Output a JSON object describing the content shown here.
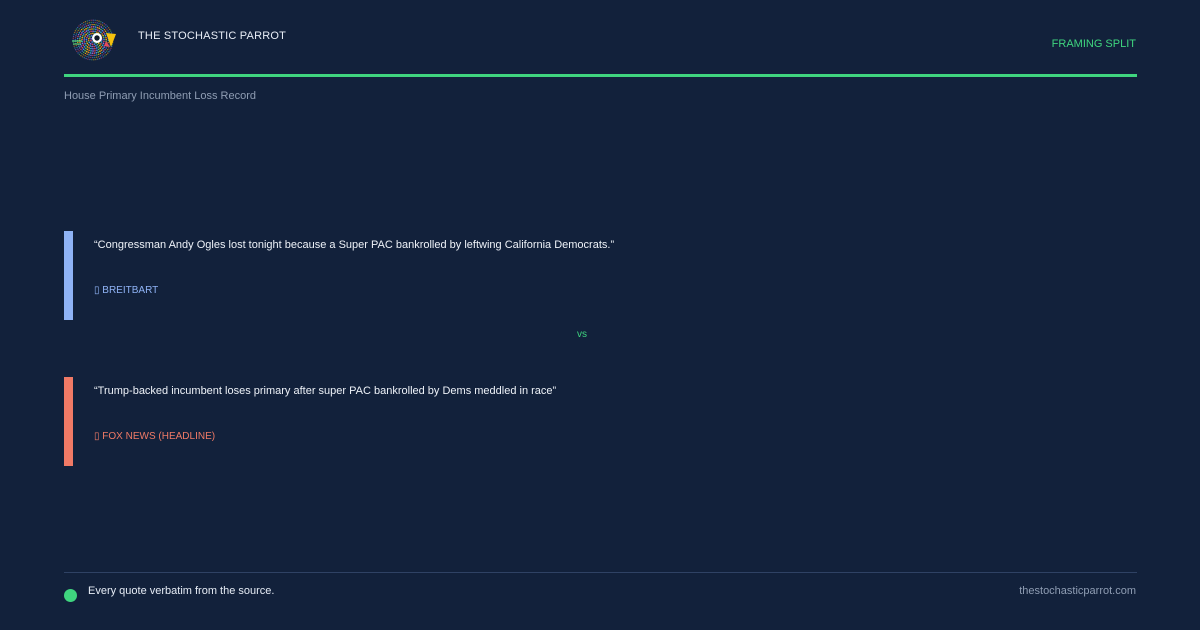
{
  "header": {
    "brand": "THE STOCHASTIC PARROT",
    "tag": "FRAMING SPLIT",
    "subtitle": "House Primary Incumbent Loss Record",
    "logo_icon": "parrot-logo-icon"
  },
  "quotes": [
    {
      "text": "“Congressman Andy Ogles lost tonight because a Super PAC bankrolled by leftwing California Democrats.”",
      "source": "▯ BREITBART",
      "color": "#8fb3f5"
    },
    {
      "text": "“Trump-backed incumbent loses primary after super PAC bankrolled by Dems meddled in race”",
      "source": "▯ FOX NEWS (HEADLINE)",
      "color": "#f07a66"
    }
  ],
  "divider": {
    "label": "vs"
  },
  "footer": {
    "note": "Every quote verbatim from the source.",
    "url": "thestochasticparrot.com"
  },
  "colors": {
    "background": "#12213b",
    "accent": "#3fd57f",
    "muted": "#8f9db3"
  }
}
